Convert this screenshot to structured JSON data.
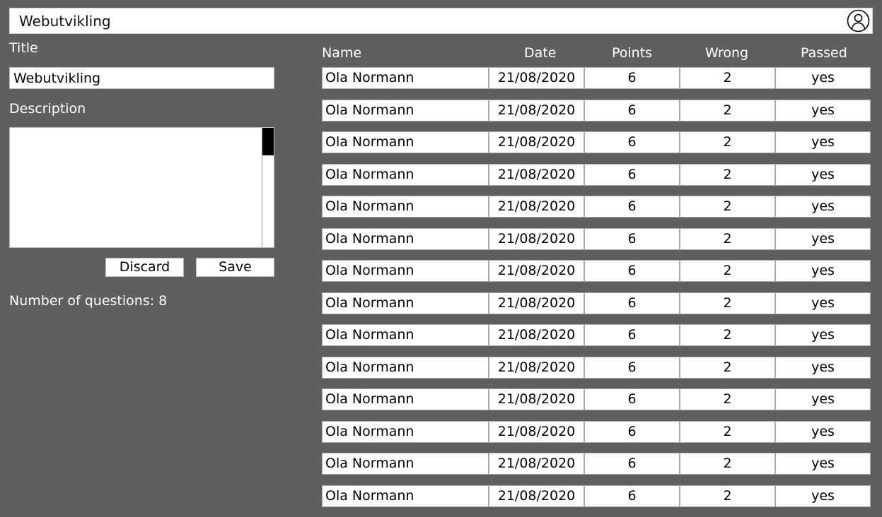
{
  "header": {
    "title": "Webutvikling",
    "account_icon": "account-circle-icon"
  },
  "form": {
    "title_label": "Title",
    "title_value": "Webutvikling",
    "description_label": "Description",
    "description_value": "",
    "discard_label": "Discard",
    "save_label": "Save",
    "question_count_text": "Number of questions: 8"
  },
  "results": {
    "columns": [
      "Name",
      "Date",
      "Points",
      "Wrong",
      "Passed"
    ],
    "rows": [
      {
        "name": "Ola Normann",
        "date": "21/08/2020",
        "points": "6",
        "wrong": "2",
        "passed": "yes"
      },
      {
        "name": "Ola Normann",
        "date": "21/08/2020",
        "points": "6",
        "wrong": "2",
        "passed": "yes"
      },
      {
        "name": "Ola Normann",
        "date": "21/08/2020",
        "points": "6",
        "wrong": "2",
        "passed": "yes"
      },
      {
        "name": "Ola Normann",
        "date": "21/08/2020",
        "points": "6",
        "wrong": "2",
        "passed": "yes"
      },
      {
        "name": "Ola Normann",
        "date": "21/08/2020",
        "points": "6",
        "wrong": "2",
        "passed": "yes"
      },
      {
        "name": "Ola Normann",
        "date": "21/08/2020",
        "points": "6",
        "wrong": "2",
        "passed": "yes"
      },
      {
        "name": "Ola Normann",
        "date": "21/08/2020",
        "points": "6",
        "wrong": "2",
        "passed": "yes"
      },
      {
        "name": "Ola Normann",
        "date": "21/08/2020",
        "points": "6",
        "wrong": "2",
        "passed": "yes"
      },
      {
        "name": "Ola Normann",
        "date": "21/08/2020",
        "points": "6",
        "wrong": "2",
        "passed": "yes"
      },
      {
        "name": "Ola Normann",
        "date": "21/08/2020",
        "points": "6",
        "wrong": "2",
        "passed": "yes"
      },
      {
        "name": "Ola Normann",
        "date": "21/08/2020",
        "points": "6",
        "wrong": "2",
        "passed": "yes"
      },
      {
        "name": "Ola Normann",
        "date": "21/08/2020",
        "points": "6",
        "wrong": "2",
        "passed": "yes"
      },
      {
        "name": "Ola Normann",
        "date": "21/08/2020",
        "points": "6",
        "wrong": "2",
        "passed": "yes"
      },
      {
        "name": "Ola Normann",
        "date": "21/08/2020",
        "points": "6",
        "wrong": "2",
        "passed": "yes"
      }
    ]
  },
  "colors": {
    "background": "#5f5f5f",
    "surface": "#ffffff",
    "text_on_background": "#ffffff"
  }
}
